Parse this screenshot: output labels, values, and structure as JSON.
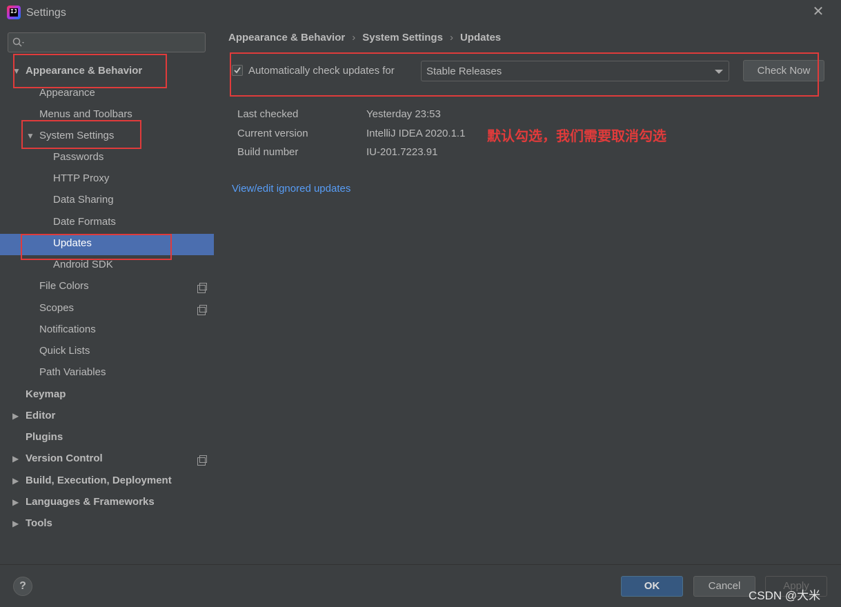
{
  "window": {
    "title": "Settings"
  },
  "sidebar": {
    "search_placeholder": "",
    "tree": {
      "appearance_behavior": "Appearance & Behavior",
      "appearance": "Appearance",
      "menus_toolbars": "Menus and Toolbars",
      "system_settings": "System Settings",
      "passwords": "Passwords",
      "http_proxy": "HTTP Proxy",
      "data_sharing": "Data Sharing",
      "date_formats": "Date Formats",
      "updates": "Updates",
      "android_sdk": "Android SDK",
      "file_colors": "File Colors",
      "scopes": "Scopes",
      "notifications": "Notifications",
      "quick_lists": "Quick Lists",
      "path_variables": "Path Variables",
      "keymap": "Keymap",
      "editor": "Editor",
      "plugins": "Plugins",
      "version_control": "Version Control",
      "build": "Build, Execution, Deployment",
      "languages": "Languages & Frameworks",
      "tools": "Tools"
    },
    "selected": "Updates"
  },
  "main": {
    "breadcrumb": [
      "Appearance & Behavior",
      "System Settings",
      "Updates"
    ],
    "auto_check": {
      "checked": true,
      "label": "Automatically check updates for"
    },
    "channel": {
      "value": "Stable Releases"
    },
    "check_now": "Check Now",
    "info": {
      "last_checked_label": "Last checked",
      "last_checked_value": "Yesterday 23:53",
      "current_version_label": "Current version",
      "current_version_value": "IntelliJ IDEA 2020.1.1",
      "build_number_label": "Build number",
      "build_number_value": "IU-201.7223.91"
    },
    "annotation": "默认勾选，我们需要取消勾选",
    "ignored_link": "View/edit ignored updates"
  },
  "footer": {
    "help": "?",
    "ok": "OK",
    "cancel": "Cancel",
    "apply": "Apply",
    "watermark": "CSDN @大米"
  },
  "colors": {
    "background": "#3c3f41",
    "selection": "#4b6eaf",
    "annotation": "#e03b3b",
    "link": "#589df6",
    "ok_button": "#365880"
  },
  "icons": [
    "intellij-app-icon",
    "close-icon",
    "search-icon",
    "expand-arrow-icon",
    "collapse-arrow-icon",
    "copy-icon",
    "checkmark-icon",
    "dropdown-caret-icon",
    "help-icon"
  ]
}
